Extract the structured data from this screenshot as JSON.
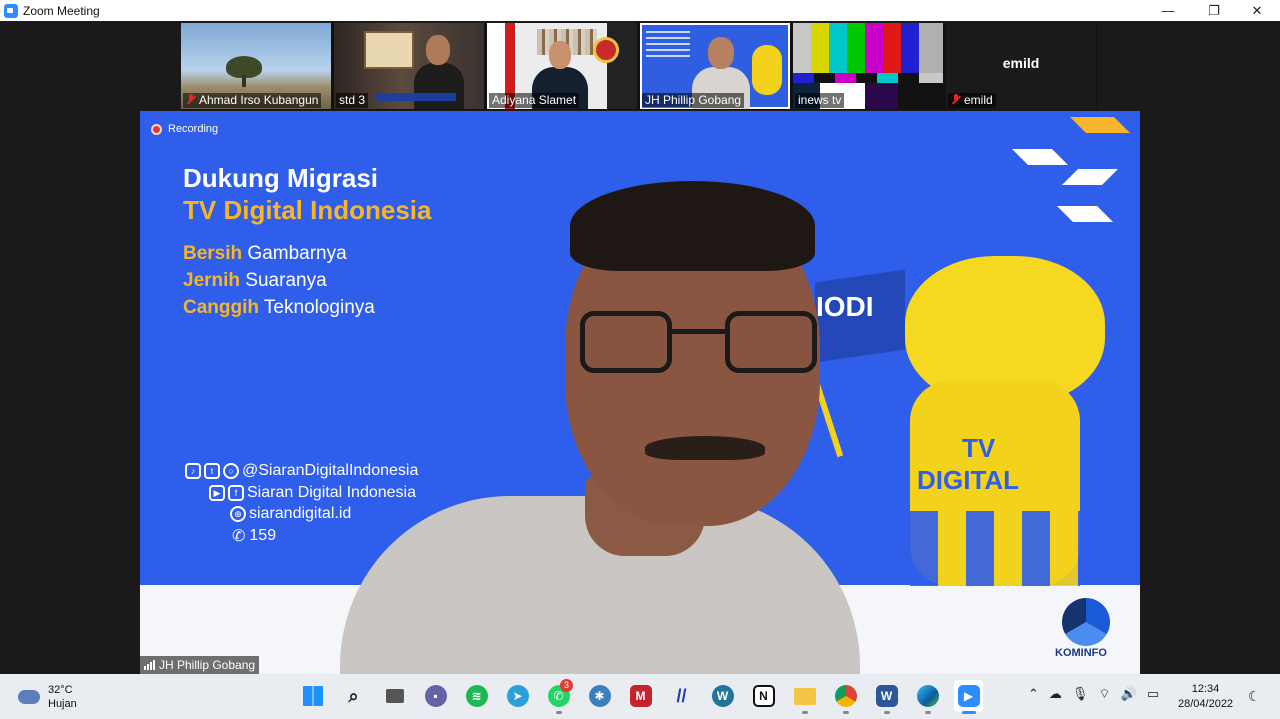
{
  "window": {
    "title": "Zoom Meeting",
    "controls": [
      "—",
      "❐",
      "✕"
    ]
  },
  "thumbnails": [
    {
      "name": "Ahmad Irso Kubangun",
      "muted": true
    },
    {
      "name": "std 3",
      "muted": false
    },
    {
      "name": "Adiyana Slamet",
      "muted": false
    },
    {
      "name": "JH Phillip Gobang",
      "muted": false,
      "active": true
    },
    {
      "name": "inews tv",
      "muted": false
    },
    {
      "name": "emild",
      "muted": true,
      "display_name": "emild"
    }
  ],
  "main": {
    "recording": "Recording",
    "headline1": "Dukung Migrasi",
    "headline2": "TV Digital Indonesia",
    "lines": [
      {
        "hl": "Bersih",
        "rest": " Gambarnya"
      },
      {
        "hl": "Jernih",
        "rest": " Suaranya"
      },
      {
        "hl": "Canggih",
        "rest": " Teknologinya"
      }
    ],
    "social": [
      "@SiaranDigitalIndonesia",
      "Siaran Digital Indonesia",
      "siarandigital.id",
      "159"
    ],
    "flag_text": "IODI",
    "mascot_line1": "TV",
    "mascot_line2": "DIGITAL",
    "logo_text": "KOMINFO",
    "speaker": "JH Phillip Gobang"
  },
  "taskbar": {
    "temp": "32°C",
    "weather": "Hujan",
    "whatsapp_badge": "3",
    "time": "12:34",
    "date": "28/04/2022"
  },
  "colors": {
    "accent": "#2f5eea",
    "gold": "#f7b52c",
    "zoom": "#2d8cff"
  }
}
